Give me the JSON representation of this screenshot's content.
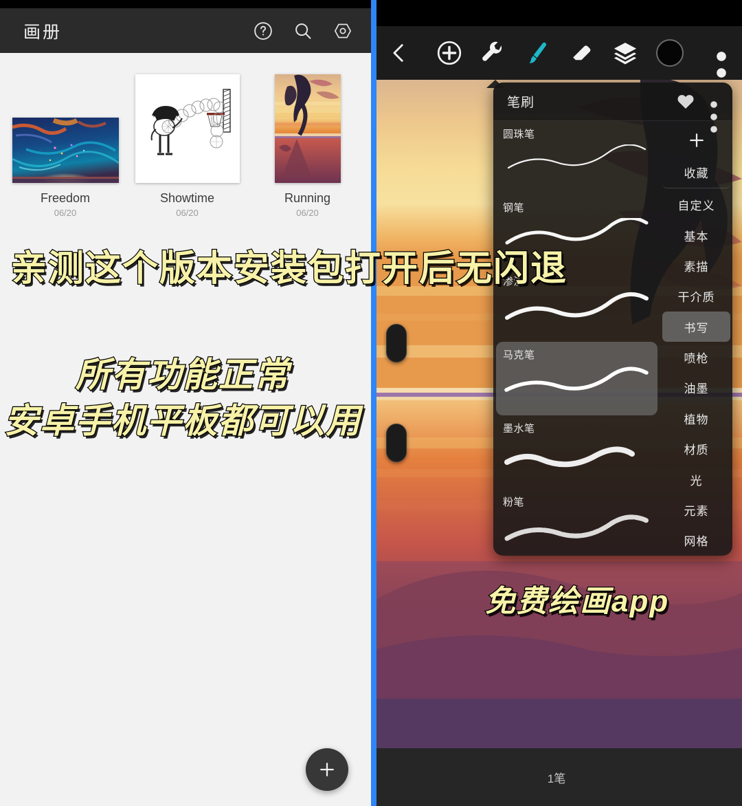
{
  "left_panel": {
    "header": {
      "title": "画册",
      "icons": [
        {
          "name": "help-icon",
          "label": "help"
        },
        {
          "name": "search-icon",
          "label": "search"
        },
        {
          "name": "settings-hexagon-icon",
          "label": "settings"
        }
      ]
    },
    "gallery": [
      {
        "name": "Freedom",
        "date": "06/20",
        "art": "abstract-blue-orange"
      },
      {
        "name": "Showtime",
        "date": "06/20",
        "art": "basketball-sketch"
      },
      {
        "name": "Running",
        "date": "06/20",
        "art": "sunset-runner"
      }
    ],
    "fab": {
      "label": "+",
      "name": "new-artwork-button"
    }
  },
  "right_panel": {
    "toolbar": {
      "back": "‹",
      "tools": [
        {
          "name": "add-icon",
          "label": "add"
        },
        {
          "name": "wrench-icon",
          "label": "adjust"
        },
        {
          "name": "brush-icon",
          "label": "brush",
          "active": true
        },
        {
          "name": "eraser-icon",
          "label": "eraser"
        },
        {
          "name": "layers-icon",
          "label": "layers"
        },
        {
          "name": "color-swatch",
          "label": "color",
          "color": "#050505"
        },
        {
          "name": "more-options-icon",
          "label": "more"
        }
      ]
    },
    "brush_panel": {
      "title": "笔刷",
      "favorite_icon": "heart-icon",
      "menu_icon": "kebab-menu-icon",
      "brushes": [
        {
          "label": "圆珠笔",
          "selected": false,
          "stroke": "thin-smooth"
        },
        {
          "label": "钢笔",
          "selected": false,
          "stroke": "medium-smooth"
        },
        {
          "label": "渗流",
          "selected": false,
          "stroke": "medium-smooth"
        },
        {
          "label": "马克笔",
          "selected": true,
          "stroke": "marker-taper"
        },
        {
          "label": "墨水笔",
          "selected": false,
          "stroke": "ink-bulge"
        },
        {
          "label": "粉笔",
          "selected": false,
          "stroke": "chalk-grain"
        }
      ],
      "add_button": "+",
      "categories": [
        {
          "label": "收藏",
          "selected": false
        },
        {
          "label": "自定义",
          "selected": false
        },
        {
          "label": "基本",
          "selected": false
        },
        {
          "label": "素描",
          "selected": false
        },
        {
          "label": "干介质",
          "selected": false
        },
        {
          "label": "书写",
          "selected": true
        },
        {
          "label": "喷枪",
          "selected": false
        },
        {
          "label": "油墨",
          "selected": false
        },
        {
          "label": "植物",
          "selected": false
        },
        {
          "label": "材质",
          "selected": false
        },
        {
          "label": "光",
          "selected": false
        },
        {
          "label": "元素",
          "selected": false
        },
        {
          "label": "网格",
          "selected": false
        }
      ]
    },
    "status_bar": {
      "text": "1笔"
    }
  },
  "captions": [
    {
      "text": "亲测这个版本安装包打开后无闪退",
      "color": "#f7f2a8"
    },
    {
      "text": "所有功能正常",
      "color": "#f7f2a8"
    },
    {
      "text": "安卓手机平板都可以用",
      "color": "#f7f2a8"
    },
    {
      "text": "免费绘画app",
      "color": "#f7f2a8"
    }
  ],
  "theme": {
    "accent_brush": "#1fb6c8",
    "divider": "#2f86f7",
    "header_bg": "#2b2b2b",
    "gallery_bg": "#f2f2f2",
    "panel_bg": "#181818"
  }
}
